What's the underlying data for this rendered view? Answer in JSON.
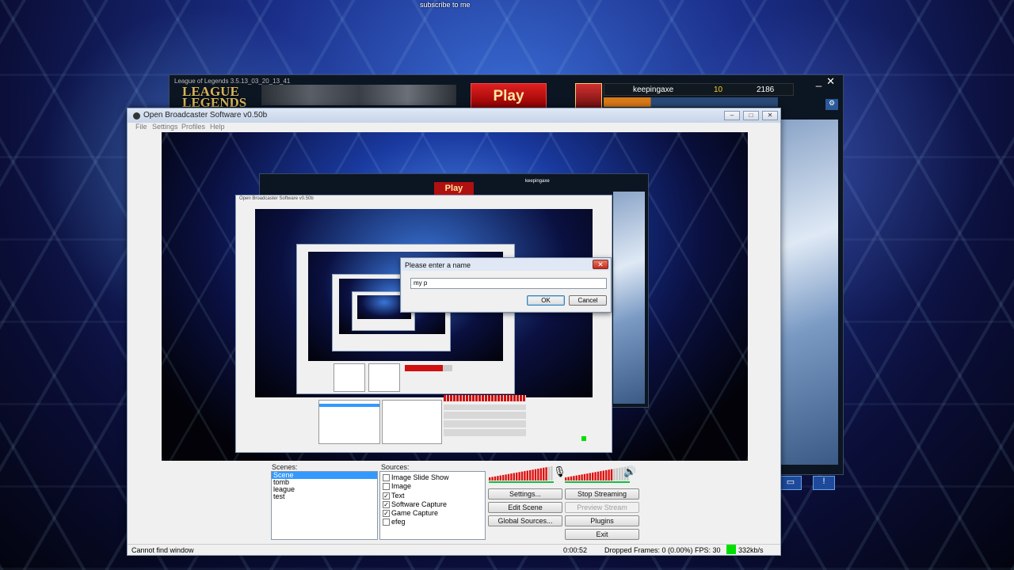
{
  "overlay_text": "subscribe to me",
  "lol": {
    "window_title": "League of Legends 3.5.13_03_20_13_41",
    "logo": [
      "LEAGUE",
      "of",
      "LEGENDS"
    ],
    "play_label": "Play",
    "username": "keepingaxe",
    "ip": "10",
    "rp": "2186",
    "minimize": "_",
    "close": "✕",
    "help": "?"
  },
  "obs": {
    "title": "Open Broadcaster Software v0.50b",
    "menu": [
      "File",
      "Settings",
      "Profiles",
      "Help"
    ],
    "scenes_label": "Scenes:",
    "sources_label": "Sources:",
    "scenes": [
      {
        "label": "Scene",
        "selected": true
      },
      {
        "label": "tomb",
        "selected": false
      },
      {
        "label": "league",
        "selected": false
      },
      {
        "label": "test",
        "selected": false
      }
    ],
    "sources": [
      {
        "label": "Image Slide Show",
        "checked": false
      },
      {
        "label": "Image",
        "checked": false
      },
      {
        "label": "Text",
        "checked": true
      },
      {
        "label": "Software Capture",
        "checked": true
      },
      {
        "label": "Game Capture",
        "checked": true
      },
      {
        "label": "efeg",
        "checked": false
      }
    ],
    "buttons": {
      "settings": "Settings...",
      "stop_streaming": "Stop Streaming",
      "edit_scene": "Edit Scene",
      "preview_stream": "Preview Stream",
      "global_sources": "Global Sources...",
      "plugins": "Plugins",
      "exit": "Exit"
    },
    "status": {
      "message": "Cannot find window",
      "time": "0:00:52",
      "dropped_frames": "Dropped Frames: 0 (0.00%)",
      "fps": "FPS: 30",
      "bitrate": "332kb/s"
    },
    "meter": {
      "left_level": 0.9,
      "right_level": 0.75,
      "active_color": "#e01010",
      "inactive_color": "#c8c8c8",
      "base_color": "#10c040"
    },
    "bitrate_indicator_color": "#00e000"
  },
  "dialog": {
    "title": "Please enter a name",
    "input_value": "my p",
    "ok_label": "OK",
    "cancel_label": "Cancel",
    "close": "✕"
  }
}
